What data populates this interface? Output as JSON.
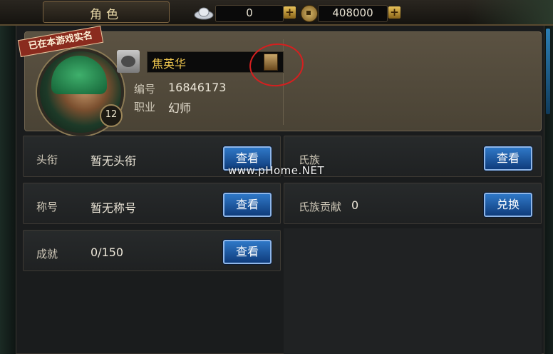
{
  "header": {
    "title": "角色",
    "silver": "0",
    "gold": "408000",
    "plus_label": "+"
  },
  "profile": {
    "realname_badge": "已在本游戏实名",
    "level": "12",
    "name": "焦英华",
    "id_label": "编号",
    "id_value": "16846173",
    "job_label": "职业",
    "job_value": "幻师"
  },
  "rows": [
    {
      "label": "头衔",
      "value": "暂无头衔",
      "button": "查看"
    },
    {
      "label": "氏族",
      "value": "",
      "button": "查看"
    },
    {
      "label": "称号",
      "value": "暂无称号",
      "button": "查看"
    },
    {
      "label": "氏族贡献",
      "value": "0",
      "button": "兑换"
    },
    {
      "label": "成就",
      "value": "0/150",
      "button": "查看"
    }
  ],
  "watermark": "www.pHome.NET",
  "colors": {
    "gold_text": "#f2c94f",
    "button_blue": "#1f5aa3",
    "annotation_red": "#d61f1f"
  }
}
